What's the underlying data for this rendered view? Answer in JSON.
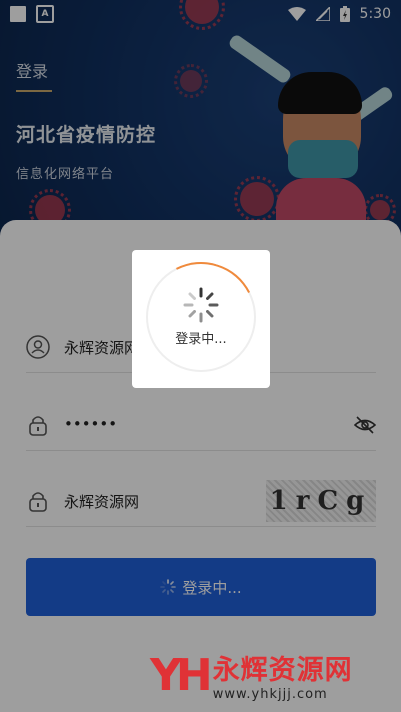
{
  "status_bar": {
    "time": "5:30",
    "app_icon_letter": "A"
  },
  "header": {
    "page_label": "登录",
    "app_title": "河北省疫情防控",
    "app_subtitle": "信息化网络平台"
  },
  "form": {
    "username": {
      "value": "永辉资源网",
      "icon": "user-icon"
    },
    "password": {
      "value": "••••••",
      "icon": "lock-icon",
      "toggle_icon": "eye-off-icon"
    },
    "captcha": {
      "value": "永辉资源网",
      "icon": "lock-icon",
      "image_text": "1rCg"
    },
    "login_button_label": "登录中..."
  },
  "loading": {
    "text": "登录中..."
  },
  "watermark": {
    "logo": "YH",
    "title": "永辉资源网",
    "url": "www.yhkjjj.com"
  },
  "colors": {
    "primary": "#1f5fd9",
    "spinner_accent": "#f08a3c",
    "watermark": "#e03236"
  }
}
